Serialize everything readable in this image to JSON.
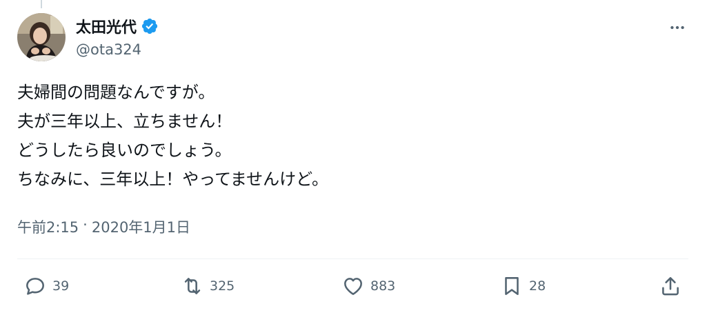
{
  "author": {
    "display_name": "太田光代",
    "handle": "@ota324",
    "verified": true,
    "verified_color": "#1d9bf0"
  },
  "tweet": {
    "lines": [
      "夫婦間の問題なんですが。",
      "夫が三年以上、立ちません！",
      "どうしたら良いのでしょう。",
      "ちなみに、三年以上！やってませんけど。"
    ],
    "time": "午前2:15",
    "separator": "·",
    "date": "2020年1月1日"
  },
  "actions": {
    "replies": "39",
    "retweets": "325",
    "likes": "883",
    "bookmarks": "28"
  },
  "icons": {
    "more": "more-horizontal-icon",
    "reply": "reply-icon",
    "retweet": "retweet-icon",
    "like": "heart-icon",
    "bookmark": "bookmark-icon",
    "share": "share-icon"
  },
  "colors": {
    "text_primary": "#0f1419",
    "text_secondary": "#536471",
    "divider": "#eff3f4",
    "accent": "#1d9bf0"
  }
}
